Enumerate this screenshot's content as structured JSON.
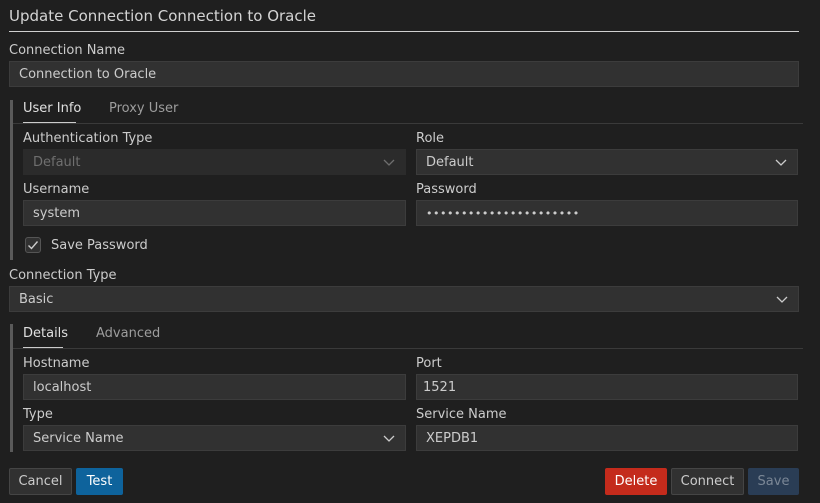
{
  "dialog": {
    "title": "Update Connection Connection to Oracle"
  },
  "connection_name": {
    "label": "Connection Name",
    "value": "Connection to Oracle"
  },
  "auth_tabs": [
    {
      "label": "User Info",
      "active": true
    },
    {
      "label": "Proxy User",
      "active": false
    }
  ],
  "user_info": {
    "auth_type": {
      "label": "Authentication Type",
      "value": "Default",
      "disabled": true
    },
    "role": {
      "label": "Role",
      "value": "Default"
    },
    "username": {
      "label": "Username",
      "value": "system"
    },
    "password": {
      "label": "Password",
      "value": "••••••••••••••••••••••"
    },
    "save_password": {
      "label": "Save Password",
      "checked": true
    }
  },
  "connection_type": {
    "label": "Connection Type",
    "value": "Basic"
  },
  "detail_tabs": [
    {
      "label": "Details",
      "active": true
    },
    {
      "label": "Advanced",
      "active": false
    }
  ],
  "details": {
    "hostname": {
      "label": "Hostname",
      "value": "localhost"
    },
    "port": {
      "label": "Port",
      "value": "1521"
    },
    "type": {
      "label": "Type",
      "value": "Service Name"
    },
    "service_name": {
      "label": "Service Name",
      "value": "XEPDB1"
    }
  },
  "buttons": {
    "cancel": "Cancel",
    "test": "Test",
    "delete": "Delete",
    "connect": "Connect",
    "save": "Save"
  },
  "icons": {
    "dropdown": "chevron-down-icon",
    "checkbox": "checkmark-icon"
  },
  "colors": {
    "primary": "#0e639c",
    "danger": "#c42b1c",
    "background": "#1f1f1f"
  }
}
